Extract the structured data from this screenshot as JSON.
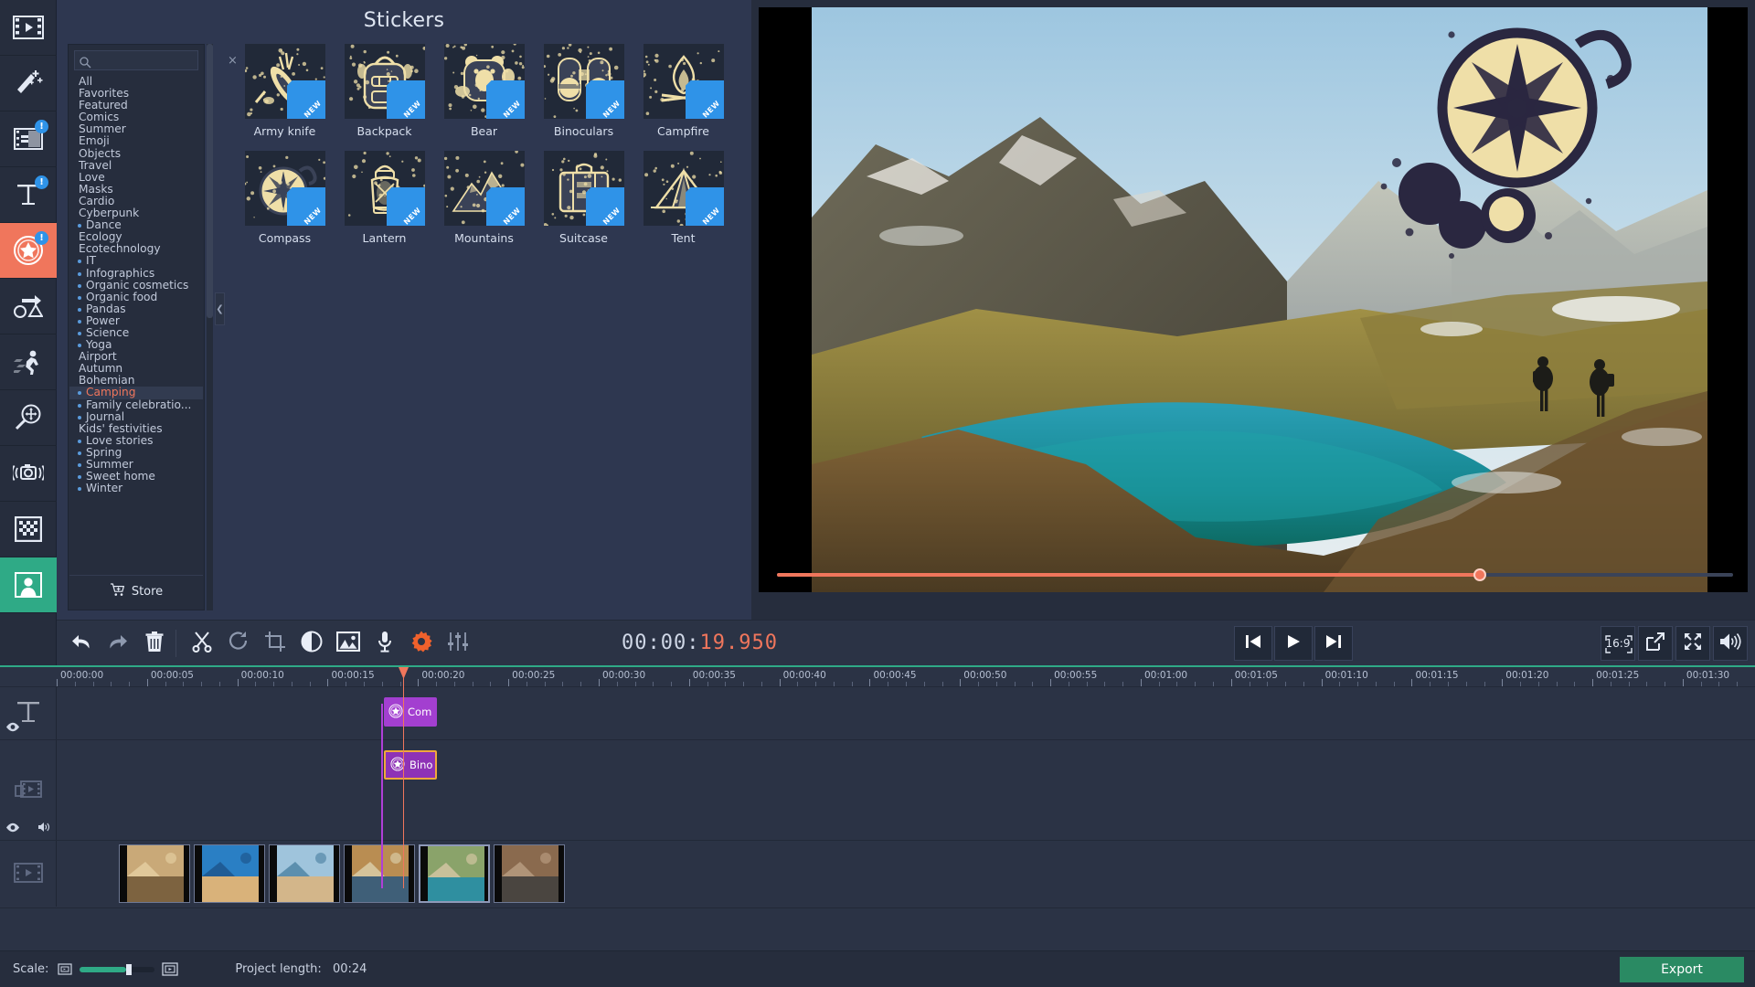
{
  "app": {
    "panel_title": "Stickers"
  },
  "rail": {
    "items": [
      {
        "name": "import-media",
        "icon": "film-play-icon",
        "badge": "",
        "active": false
      },
      {
        "name": "filters",
        "icon": "magic-wand-icon",
        "badge": "",
        "active": false
      },
      {
        "name": "transitions",
        "icon": "transition-icon",
        "badge": "!",
        "active": false
      },
      {
        "name": "titles",
        "icon": "text-t-icon",
        "badge": "!",
        "active": false
      },
      {
        "name": "stickers",
        "icon": "sticker-star-icon",
        "badge": "!",
        "active": true
      },
      {
        "name": "animation",
        "icon": "shapes-arrow-icon",
        "badge": "",
        "active": false
      },
      {
        "name": "motion-tracking",
        "icon": "running-man-icon",
        "badge": "",
        "active": false
      },
      {
        "name": "pan-and-zoom",
        "icon": "magnifier-move-icon",
        "badge": "",
        "active": false
      },
      {
        "name": "stabilization",
        "icon": "camera-shake-icon",
        "badge": "",
        "active": false
      },
      {
        "name": "chroma-key",
        "icon": "checkerboard-icon",
        "badge": "",
        "active": false
      },
      {
        "name": "highlight-and-conceal",
        "icon": "person-icon",
        "badge": "",
        "active": false
      }
    ]
  },
  "search": {
    "value": "",
    "placeholder": "",
    "clear_label": "×"
  },
  "categories": {
    "selected": "Camping",
    "items": [
      {
        "label": "All",
        "dotted": false
      },
      {
        "label": "Favorites",
        "dotted": false
      },
      {
        "label": "Featured",
        "dotted": false
      },
      {
        "label": "Comics",
        "dotted": false
      },
      {
        "label": "Summer",
        "dotted": false
      },
      {
        "label": "Emoji",
        "dotted": false
      },
      {
        "label": "Objects",
        "dotted": false
      },
      {
        "label": "Travel",
        "dotted": false
      },
      {
        "label": "Love",
        "dotted": false
      },
      {
        "label": "Masks",
        "dotted": false
      },
      {
        "label": "Cardio",
        "dotted": false
      },
      {
        "label": "Cyberpunk",
        "dotted": false
      },
      {
        "label": "Dance",
        "dotted": true
      },
      {
        "label": "Ecology",
        "dotted": false
      },
      {
        "label": "Ecotechnology",
        "dotted": false
      },
      {
        "label": "IT",
        "dotted": true
      },
      {
        "label": "Infographics",
        "dotted": true
      },
      {
        "label": "Organic cosmetics",
        "dotted": true
      },
      {
        "label": "Organic food",
        "dotted": true
      },
      {
        "label": "Pandas",
        "dotted": true
      },
      {
        "label": "Power",
        "dotted": true
      },
      {
        "label": "Science",
        "dotted": true
      },
      {
        "label": "Yoga",
        "dotted": true
      },
      {
        "label": "Airport",
        "dotted": false
      },
      {
        "label": "Autumn",
        "dotted": false
      },
      {
        "label": "Bohemian",
        "dotted": false
      },
      {
        "label": "Camping",
        "dotted": true
      },
      {
        "label": "Family celebratio...",
        "dotted": true
      },
      {
        "label": "Journal",
        "dotted": true
      },
      {
        "label": "Kids' festivities",
        "dotted": false
      },
      {
        "label": "Love stories",
        "dotted": true
      },
      {
        "label": "Spring",
        "dotted": true
      },
      {
        "label": "Summer",
        "dotted": true
      },
      {
        "label": "Sweet home",
        "dotted": true
      },
      {
        "label": "Winter",
        "dotted": true
      }
    ]
  },
  "store": {
    "label": "Store",
    "icon": "cart-plus-icon"
  },
  "stickers": {
    "badge_text": "NEW",
    "items": [
      {
        "label": "Army knife",
        "icon": "army-knife-icon",
        "new": true
      },
      {
        "label": "Backpack",
        "icon": "backpack-icon",
        "new": true
      },
      {
        "label": "Bear",
        "icon": "bear-icon",
        "new": true
      },
      {
        "label": "Binoculars",
        "icon": "binoculars-icon",
        "new": true
      },
      {
        "label": "Campfire",
        "icon": "campfire-icon",
        "new": true
      },
      {
        "label": "Compass",
        "icon": "compass-icon",
        "new": true
      },
      {
        "label": "Lantern",
        "icon": "lantern-icon",
        "new": true
      },
      {
        "label": "Mountains",
        "icon": "mountains-icon",
        "new": true
      },
      {
        "label": "Suitcase",
        "icon": "suitcase-icon",
        "new": true
      },
      {
        "label": "Tent",
        "icon": "tent-icon",
        "new": true
      }
    ]
  },
  "preview": {
    "seek_percent": 73.5,
    "overlay_sticker": "compass-overlay"
  },
  "toolbar": {
    "tools": [
      {
        "name": "undo-button",
        "icon": "undo-arrow-icon"
      },
      {
        "name": "redo-button",
        "icon": "redo-arrow-icon"
      },
      {
        "name": "delete-button",
        "icon": "trash-icon"
      },
      {
        "name": "split-button",
        "icon": "scissors-icon"
      },
      {
        "name": "rotate-button",
        "icon": "rotate-icon"
      },
      {
        "name": "crop-button",
        "icon": "crop-icon"
      },
      {
        "name": "color-adjust-button",
        "icon": "contrast-circle-icon"
      },
      {
        "name": "image-properties-button",
        "icon": "picture-icon"
      },
      {
        "name": "record-audio-button",
        "icon": "microphone-icon"
      },
      {
        "name": "clip-properties-button",
        "icon": "gear-icon"
      },
      {
        "name": "audio-properties-button",
        "icon": "equalizer-icon"
      }
    ],
    "timecode": {
      "prefix": "00:00:",
      "highlight": "19.950",
      "full": "00:00:19.950"
    },
    "transport": [
      {
        "name": "previous-frame-button",
        "icon": "skip-back-icon"
      },
      {
        "name": "play-button",
        "icon": "play-icon"
      },
      {
        "name": "next-frame-button",
        "icon": "skip-forward-icon"
      }
    ],
    "right_controls": [
      {
        "name": "aspect-ratio-button",
        "icon": "aspect-ratio-icon",
        "label": "16:9"
      },
      {
        "name": "detach-preview-button",
        "icon": "detach-icon",
        "label": ""
      },
      {
        "name": "fullscreen-button",
        "icon": "fullscreen-icon",
        "label": ""
      },
      {
        "name": "volume-button",
        "icon": "speaker-icon",
        "label": ""
      }
    ]
  },
  "timeline": {
    "ruler_labels": [
      "00:00:00",
      "00:00:05",
      "00:00:10",
      "00:00:15",
      "00:00:20",
      "00:00:25",
      "00:00:30",
      "00:00:35",
      "00:00:40",
      "00:00:45",
      "00:00:50",
      "00:00:55",
      "00:01:00",
      "00:01:05",
      "00:01:10",
      "00:01:15",
      "00:01:20",
      "00:01:25",
      "00:01:30"
    ],
    "tracks": [
      {
        "name": "title-track",
        "icon": "text-t-icon",
        "has_eye": true,
        "has_speaker": false
      },
      {
        "name": "overlay-track",
        "icon": "overlay-film-icon",
        "has_eye": true,
        "has_speaker": true
      },
      {
        "name": "video-track",
        "icon": "film-icon",
        "has_eye": false,
        "has_speaker": false
      }
    ],
    "clips": [
      {
        "label": "Com",
        "track": 0,
        "style": "sticker-a",
        "selected": false,
        "icon": "sticker-star-icon"
      },
      {
        "label": "Bino",
        "track": 1,
        "style": "sticker-b",
        "selected": true,
        "icon": "sticker-star-icon"
      }
    ],
    "video_clips_count": 6,
    "selected_video_clip_index": 4,
    "playhead_time": "00:00:19.950"
  },
  "status": {
    "scale_label": "Scale:",
    "scale_percent": 62,
    "zoom_out_icon": "timeline-zoom-out-icon",
    "zoom_in_icon": "timeline-zoom-in-icon",
    "project_length_label": "Project length:",
    "project_length_value": "00:24",
    "export_label": "Export"
  },
  "colors": {
    "accent": "#f0765c",
    "blue_badge": "#2f93e8",
    "green": "#2a8a63",
    "purple_clip": "#a33fd0",
    "selection": "#f0a83c",
    "panel_bg": "#2e3750",
    "app_bg": "#2b3345"
  }
}
